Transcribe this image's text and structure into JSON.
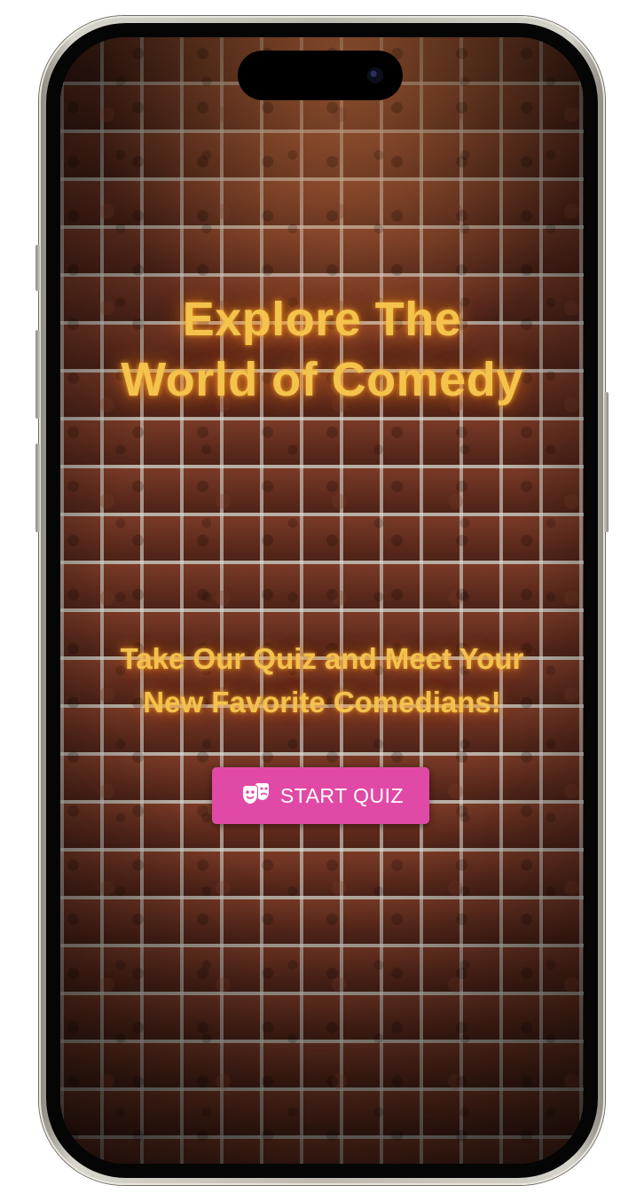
{
  "hero": {
    "title_line1": "Explore The",
    "title_line2": "World of Comedy",
    "subtitle_line1": "Take Our Quiz and Meet Your",
    "subtitle_line2": "New Favorite Comedians!"
  },
  "cta": {
    "label": "START QUIZ",
    "icon": "theater-masks-icon",
    "color": "#e04aa6"
  },
  "theme": {
    "headline_color": "#f4c34c",
    "background": "brick-wall"
  }
}
